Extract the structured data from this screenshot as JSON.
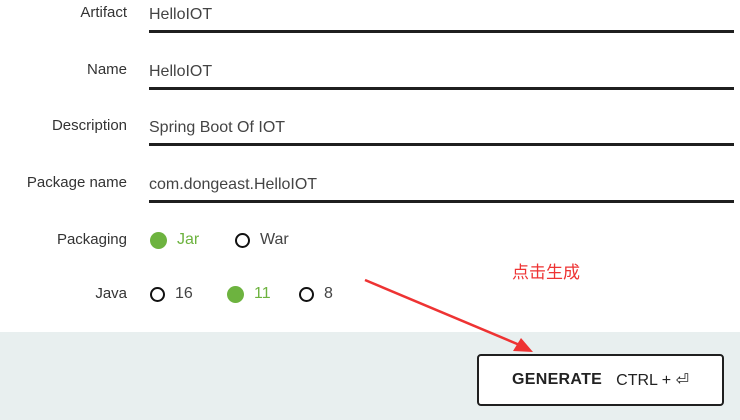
{
  "form": {
    "artifact": {
      "label": "Artifact",
      "value": "HelloIOT"
    },
    "name": {
      "label": "Name",
      "value": "HelloIOT"
    },
    "description": {
      "label": "Description",
      "value": "Spring Boot Of IOT"
    },
    "package_name": {
      "label": "Package name",
      "value": "com.dongeast.HelloIOT"
    },
    "packaging": {
      "label": "Packaging",
      "options": [
        {
          "label": "Jar",
          "selected": true
        },
        {
          "label": "War",
          "selected": false
        }
      ]
    },
    "java": {
      "label": "Java",
      "options": [
        {
          "label": "16",
          "selected": false
        },
        {
          "label": "11",
          "selected": true
        },
        {
          "label": "8",
          "selected": false
        }
      ]
    }
  },
  "footer": {
    "generate_label": "GENERATE",
    "generate_shortcut": "CTRL + ⏎"
  },
  "annotation": {
    "text": "点击生成",
    "color": "#ee3333"
  },
  "colors": {
    "accent": "#6db33f",
    "footer_bg": "#e8efef"
  }
}
